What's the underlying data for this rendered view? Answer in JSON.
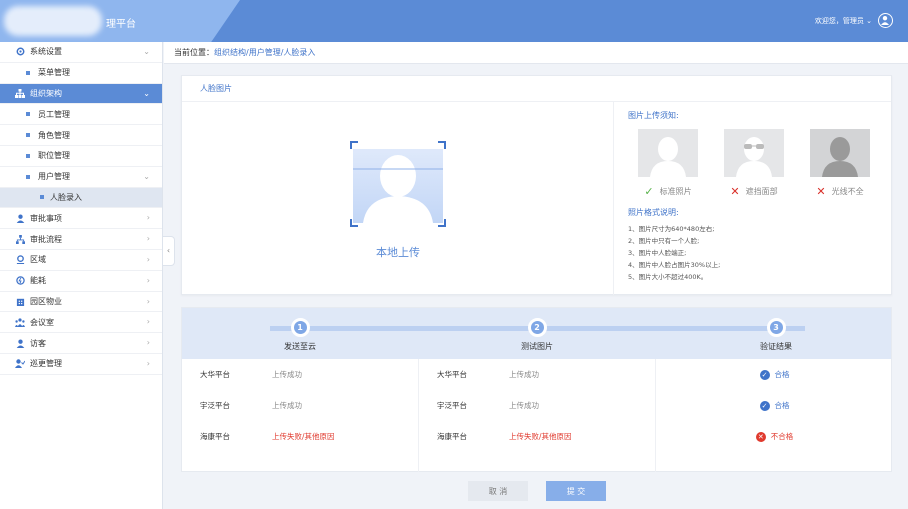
{
  "header": {
    "brand_text": "理平台",
    "welcome_text": "欢迎您，管理员 ⌄"
  },
  "sidebar": {
    "items": [
      {
        "label": "系统设置",
        "icon": "gear-icon",
        "expanded": true
      },
      {
        "label": "菜单管理",
        "level": 2
      },
      {
        "label": "组织架构",
        "icon": "org-chart-icon",
        "active": true,
        "expanded": true
      },
      {
        "label": "员工管理",
        "level": 2
      },
      {
        "label": "角色管理",
        "level": 2
      },
      {
        "label": "职位管理",
        "level": 2
      },
      {
        "label": "用户管理",
        "level": 2,
        "expanded": true
      },
      {
        "label": "人脸录入",
        "level": 3,
        "selected": true
      },
      {
        "label": "审批事项",
        "icon": "user-icon"
      },
      {
        "label": "审批流程",
        "icon": "workflow-icon"
      },
      {
        "label": "区域",
        "icon": "location-icon"
      },
      {
        "label": "能耗",
        "icon": "energy-icon"
      },
      {
        "label": "园区物业",
        "icon": "building-icon"
      },
      {
        "label": "会议室",
        "icon": "meeting-icon"
      },
      {
        "label": "访客",
        "icon": "visitor-icon"
      },
      {
        "label": "巡更管理",
        "icon": "patrol-icon"
      }
    ]
  },
  "breadcrumb": {
    "prefix": "当前位置：",
    "path": "组织结构/用户管理/人脸录入"
  },
  "face_card": {
    "title": "人脸图片",
    "upload_label": "本地上传",
    "tips_title": "图片上传须知:",
    "samples": [
      {
        "label": "标准照片",
        "status": "ok"
      },
      {
        "label": "遮挡面部",
        "status": "bad"
      },
      {
        "label": "光线不全",
        "status": "bad"
      }
    ],
    "format_title": "照片格式说明:",
    "rules": [
      "1、图片尺寸为640*480左右;",
      "2、图片中只有一个人脸;",
      "3、图片中人脸端正;",
      "4、图片中人脸占图片30%以上;",
      "5、图片大小不超过400K。"
    ]
  },
  "steps": [
    {
      "num": "1",
      "label": "发送至云"
    },
    {
      "num": "2",
      "label": "测试图片"
    },
    {
      "num": "3",
      "label": "验证结果"
    }
  ],
  "upload_results": [
    [
      {
        "platform": "大华平台",
        "status": "上传成功",
        "fail": false
      },
      {
        "platform": "宇泛平台",
        "status": "上传成功",
        "fail": false
      },
      {
        "platform": "海康平台",
        "status": "上传失败/其他原因",
        "fail": true
      }
    ],
    [
      {
        "platform": "大华平台",
        "status": "上传成功",
        "fail": false
      },
      {
        "platform": "宇泛平台",
        "status": "上传成功",
        "fail": false
      },
      {
        "platform": "海康平台",
        "status": "上传失败/其他原因",
        "fail": true
      }
    ]
  ],
  "verify_results": [
    {
      "label": "合格",
      "pass": true
    },
    {
      "label": "合格",
      "pass": true
    },
    {
      "label": "不合格",
      "pass": false
    }
  ],
  "buttons": {
    "cancel": "取 消",
    "submit": "提 交"
  },
  "colors": {
    "header": "#5b8bd6",
    "accent": "#3f73c9",
    "pass": "#3f73c9",
    "fail": "#e03a2e",
    "ok": "#58b24a"
  }
}
